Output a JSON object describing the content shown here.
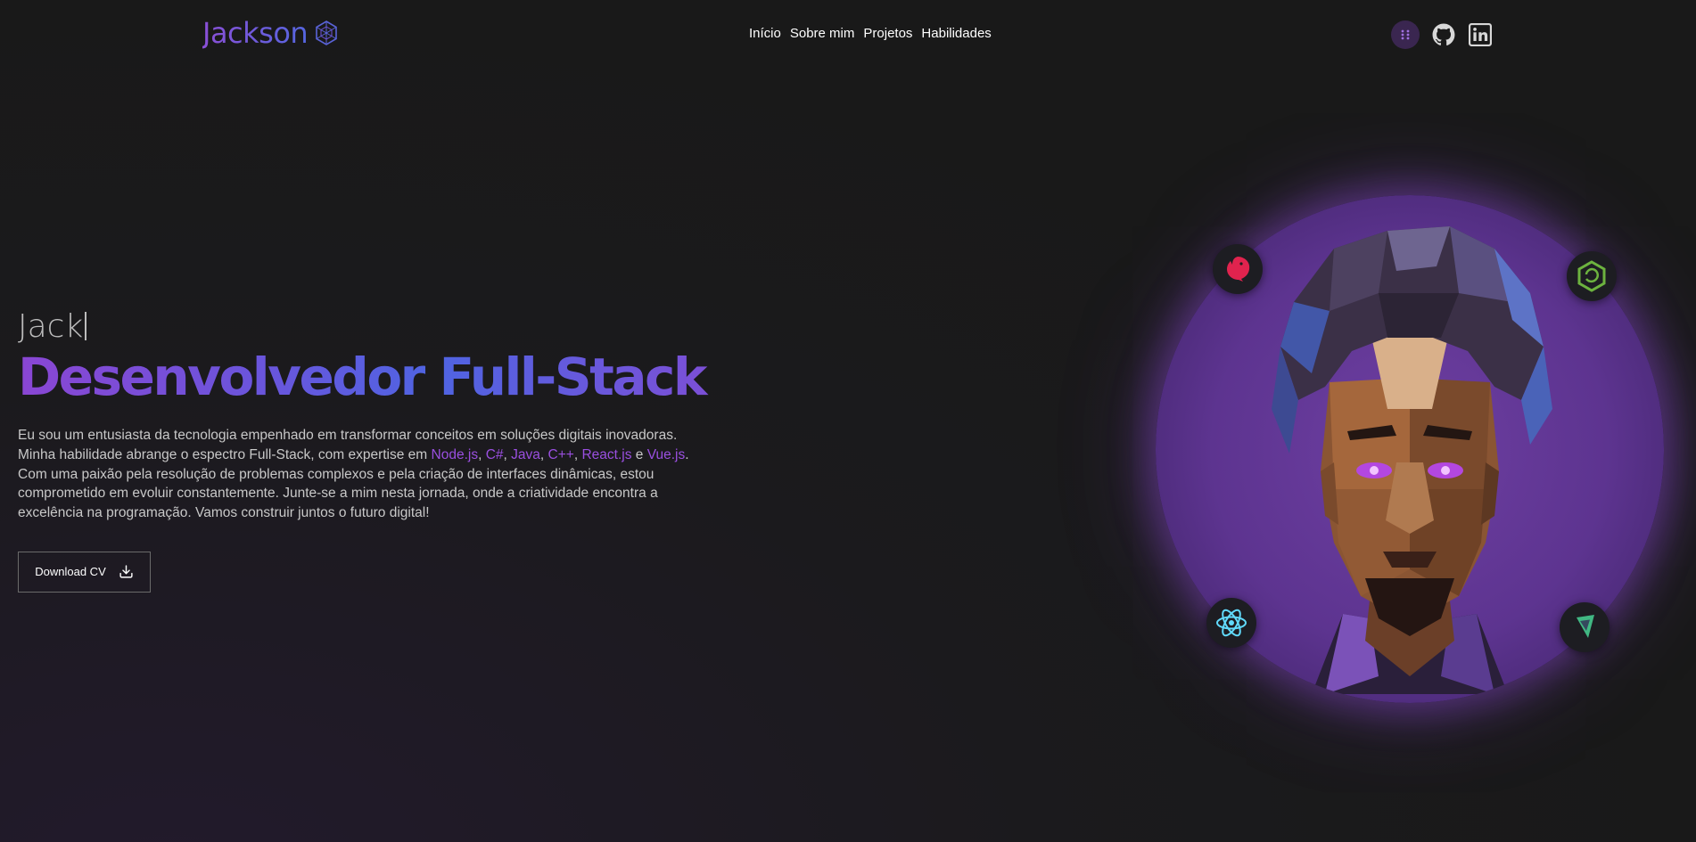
{
  "header": {
    "logo_text": "Jackson",
    "nav": [
      "Início",
      "Sobre mim",
      "Projetos",
      "Habilidades"
    ],
    "socials": [
      "menu-grid-icon",
      "github-icon",
      "linkedin-icon"
    ]
  },
  "hero": {
    "greeting": "Jack",
    "role": "Desenvolvedor Full-Stack",
    "description": {
      "part1": "Eu sou um entusiasta da tecnologia empenhado em transformar conceitos em soluções digitais inovadoras. Minha habilidade abrange o espectro Full-Stack, com expertise em ",
      "tech": [
        "Node.js",
        "C#",
        "Java",
        "C++",
        "React.js",
        "Vue.js"
      ],
      "sep_comma": ", ",
      "sep_e": " e ",
      "part2": ". Com uma paixão pela resolução de problemas complexos e pela criação de interfaces dinâmicas, estou comprometido em evoluir constantemente. Junte-se a mim nesta jornada, onde a criatividade encontra a excelência na programação. Vamos construir juntos o futuro digital!"
    },
    "cv_button": "Download CV"
  },
  "portrait": {
    "badges": [
      "nestjs-icon",
      "spring-icon",
      "react-icon",
      "vue-icon"
    ]
  },
  "colors": {
    "accent": "#9a4fe0",
    "gradient_start": "#8a46d3",
    "gradient_end": "#4f64e2",
    "background": "#1a1a1a"
  }
}
